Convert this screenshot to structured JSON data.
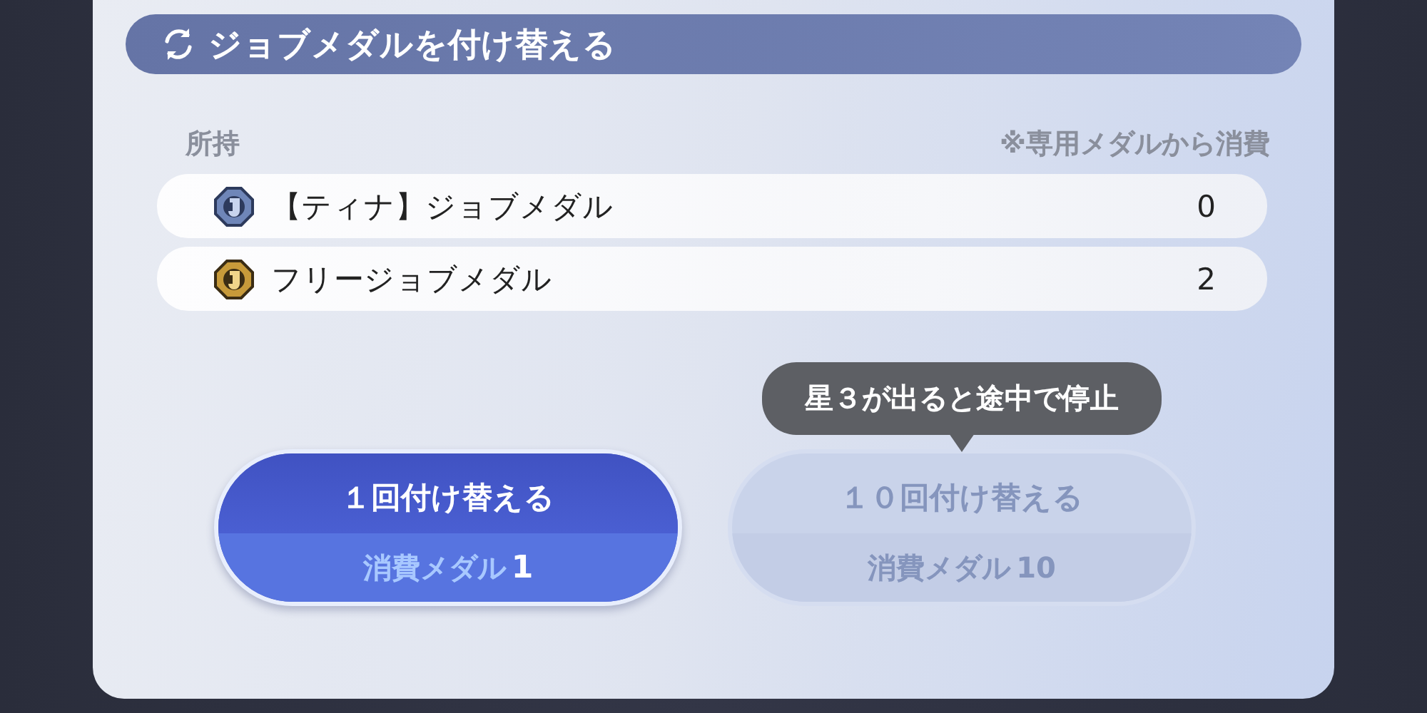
{
  "header": {
    "title": "ジョブメダルを付け替える"
  },
  "owned_label": "所持",
  "note": "※専用メダルから消費",
  "medals": [
    {
      "name": "【ティナ】ジョブメダル",
      "count": "0",
      "kind": "character"
    },
    {
      "name": "フリージョブメダル",
      "count": "2",
      "kind": "free"
    }
  ],
  "tooltip": "星３が出ると途中で停止",
  "buttons": [
    {
      "label": "１回付け替える",
      "cost_label": "消費メダル",
      "cost": "1",
      "disabled": false
    },
    {
      "label": "１０回付け替える",
      "cost_label": "消費メダル",
      "cost": "10",
      "disabled": true
    }
  ]
}
